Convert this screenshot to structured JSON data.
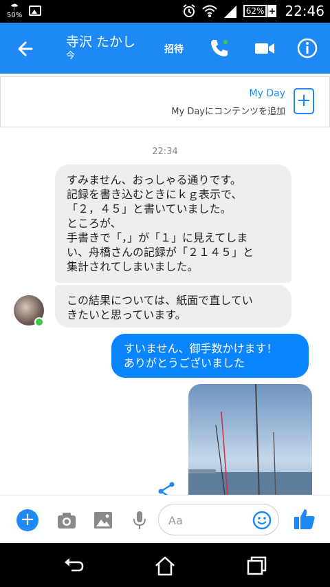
{
  "status_bar": {
    "weather_percent": "50%",
    "battery_percent": "62%",
    "time": "22:46",
    "icons": [
      "umbrella-icon",
      "gallery-icon",
      "alarm-icon",
      "wifi-icon",
      "signal-icon",
      "battery-icon"
    ]
  },
  "header": {
    "title": "寺沢 たかし",
    "subtitle": "今",
    "invite_label": "招待",
    "icons": [
      "back-arrow-icon",
      "phone-icon",
      "video-icon",
      "info-icon"
    ],
    "accent_color": "#1e88f4",
    "online_color": "#3ec54a"
  },
  "myday": {
    "title": "My Day",
    "subtitle": "My Dayにコンテンツを追加",
    "add_symbol": "+"
  },
  "conversation": {
    "timestamp": "22:34",
    "incoming_1_lines": [
      "すみません、おっしゃる通りです。",
      "記録を書き込むときにｋｇ表示で、",
      "「２，４５」と書いていました。",
      "ところが、",
      "手書きで「，」が「１」に見えてしま",
      "い、舟橋さんの記録が「２１４５」と",
      "集計されてしまいました。"
    ],
    "incoming_2_lines": [
      "この結果については、紙面で直してい",
      "きたいと思っています。"
    ],
    "outgoing_lines": [
      "すいません、御手数かけます！",
      "ありがとうございました"
    ],
    "outgoing_color": "#0a84ff"
  },
  "composer": {
    "placeholder": "Aa",
    "plus_symbol": "+",
    "icons": [
      "camera-icon",
      "image-icon",
      "microphone-icon",
      "emoji-icon",
      "like-icon"
    ]
  },
  "nav_bar": {
    "icons": [
      "back-icon",
      "home-icon",
      "recents-icon"
    ]
  }
}
